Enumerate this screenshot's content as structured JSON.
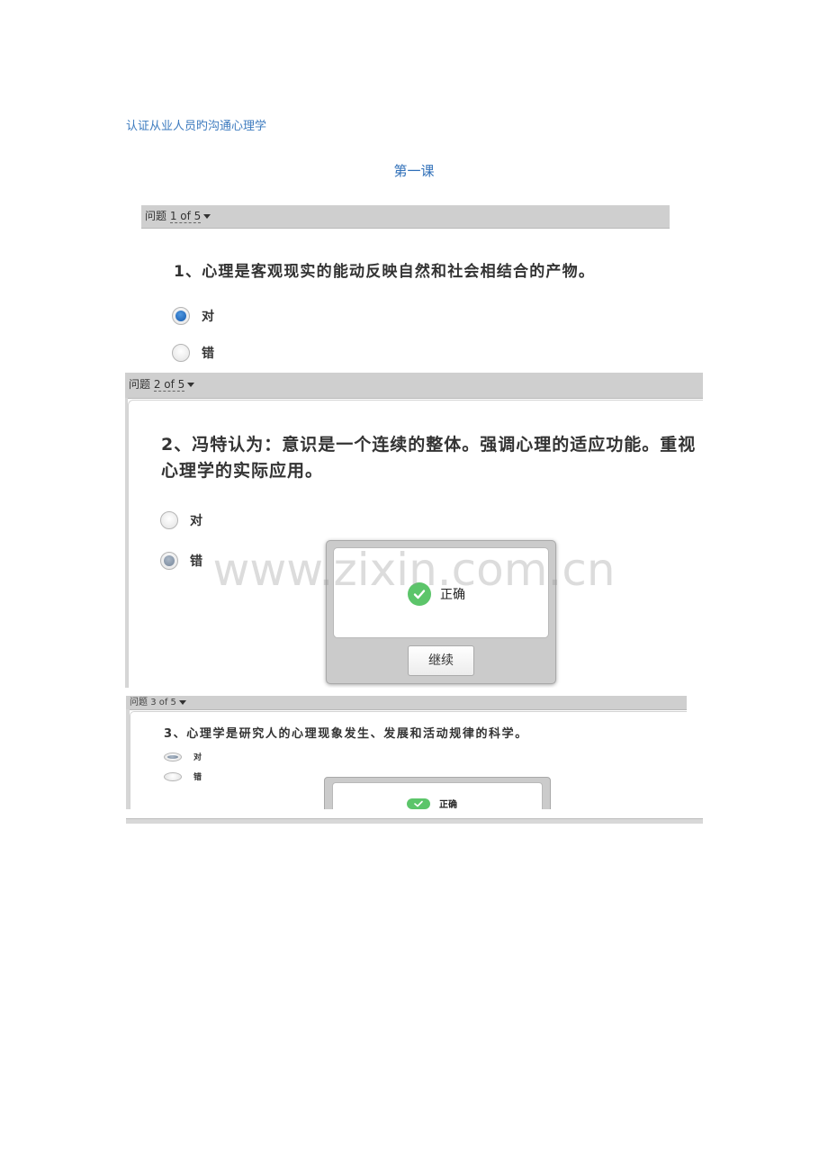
{
  "document": {
    "title": "认证从业人员旳沟通心理学",
    "lesson_title": "第一课"
  },
  "questions": [
    {
      "counter_label": "问题",
      "counter_value": "1 of 5",
      "text": "1、心理是客观现实的能动反映自然和社会相结合的产物。",
      "options": [
        {
          "label": "对",
          "checked": true
        },
        {
          "label": "错",
          "checked": false
        }
      ]
    },
    {
      "counter_label": "问题",
      "counter_value": "2 of 5",
      "text": "2、冯特认为：意识是一个连续的整体。强调心理的适应功能。重视心理学的实际应用。",
      "options": [
        {
          "label": "对",
          "checked": false
        },
        {
          "label": "错",
          "checked": true
        }
      ],
      "feedback": {
        "text": "正确",
        "button_label": "继续"
      }
    },
    {
      "counter_label": "问题",
      "counter_value": "3 of 5",
      "text": "3、心理学是研究人的心理现象发生、发展和活动规律的科学。",
      "options": [
        {
          "label": "对",
          "checked": true
        },
        {
          "label": "错",
          "checked": false
        }
      ],
      "feedback": {
        "text": "正确"
      }
    }
  ],
  "watermark": "www.zixin.com.cn",
  "colors": {
    "doc_title": "#3d7bbf",
    "lesson_title": "#2f6fb8",
    "radio_selected": "#1e63b5",
    "success": "#5cc56a",
    "bar": "#cfcfcf"
  },
  "icons": {
    "dropdown": "caret-down-icon",
    "feedback": "check-circle-icon"
  }
}
